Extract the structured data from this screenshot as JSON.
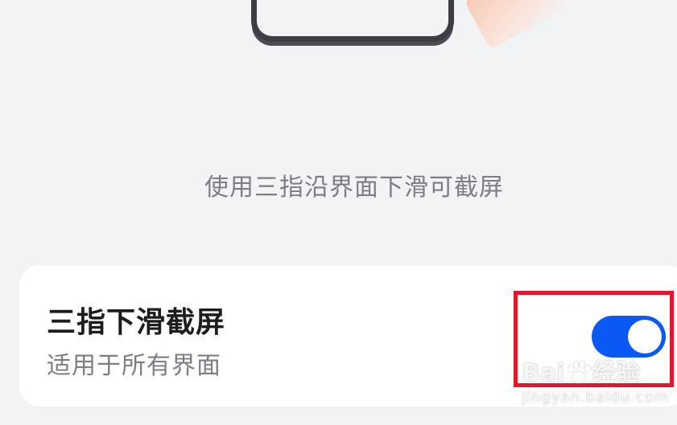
{
  "description": "使用三指沿界面下滑可截屏",
  "setting": {
    "title": "三指下滑截屏",
    "subtitle": "适用于所有界面",
    "toggle_on": true
  },
  "watermark": {
    "brand_left": "Bai",
    "brand_right": "经验",
    "url": "jingyan.baidu.com"
  },
  "colors": {
    "background": "#f2f3f5",
    "card": "#ffffff",
    "toggle_on": "#0a59f7",
    "highlight": "#e3162a",
    "text_primary": "#1c1d1f",
    "text_secondary": "#7b7e84"
  },
  "icons": {
    "watermark_logo": "paw-icon"
  }
}
